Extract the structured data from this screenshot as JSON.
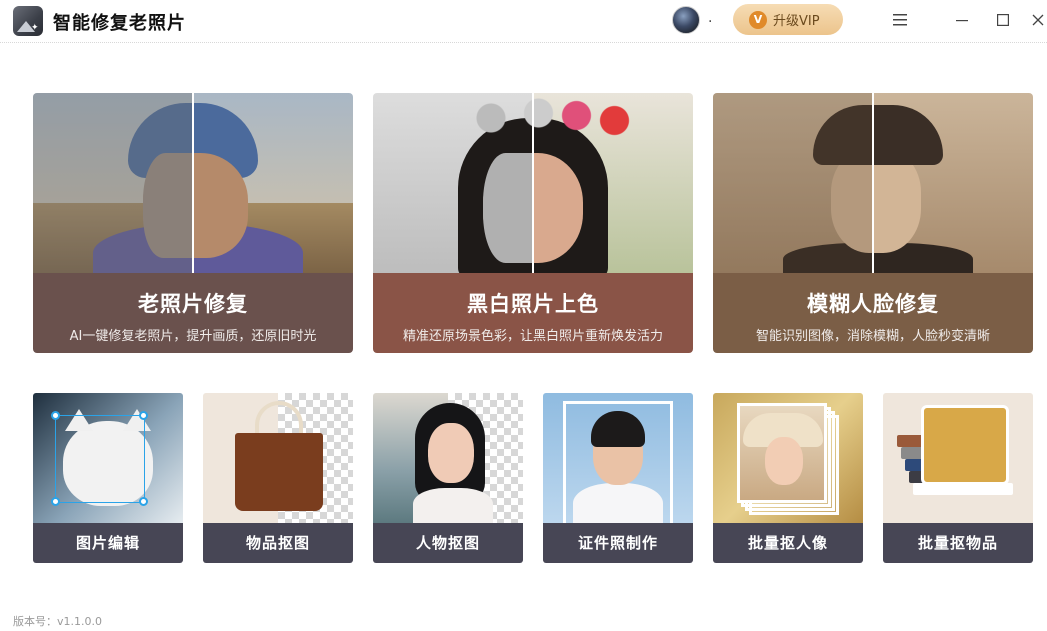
{
  "app": {
    "title": "智能修复老照片",
    "user_name": ".",
    "vip_label": "升级VIP",
    "vip_icon_letter": "V",
    "version": "版本号：v1.1.0.0"
  },
  "window_controls": {
    "menu": "☰",
    "minimize": "—",
    "maximize": "☐",
    "close": "✕"
  },
  "features_main": [
    {
      "title": "老照片修复",
      "subtitle": "AI一键修复老照片，提升画质，还原旧时光"
    },
    {
      "title": "黑白照片上色",
      "subtitle": "精准还原场景色彩，让黑白照片重新焕发活力"
    },
    {
      "title": "模糊人脸修复",
      "subtitle": "智能识别图像，消除模糊，人脸秒变清晰"
    }
  ],
  "features_tools": [
    {
      "label": "图片编辑"
    },
    {
      "label": "物品抠图"
    },
    {
      "label": "人物抠图"
    },
    {
      "label": "证件照制作"
    },
    {
      "label": "批量抠人像"
    },
    {
      "label": "批量抠物品"
    }
  ]
}
